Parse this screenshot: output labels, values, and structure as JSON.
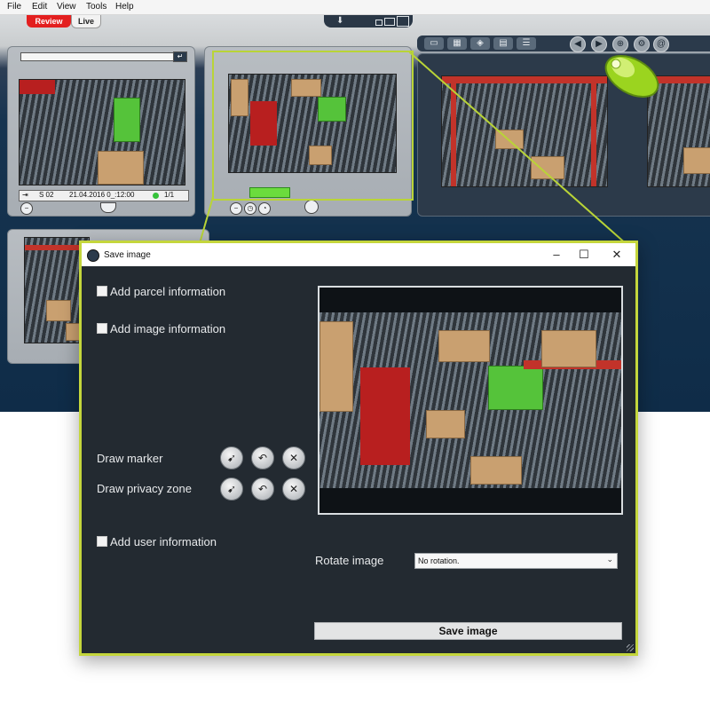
{
  "menubar": {
    "items": [
      "File",
      "Edit",
      "View",
      "Tools",
      "Help"
    ]
  },
  "modes": {
    "review_label": "Review",
    "live_label": "Live",
    "active": "Review"
  },
  "camera_panel": {
    "station": "S 02",
    "datetime": "21.04.2016 0_:12:00",
    "count": "1/1"
  },
  "dialog": {
    "title": "Save image",
    "checkboxes": {
      "parcel": "Add parcel information",
      "image": "Add image information",
      "user": "Add user information"
    },
    "tools": {
      "draw_marker": "Draw marker",
      "draw_privacy_zone": "Draw privacy zone"
    },
    "rotate_label": "Rotate image",
    "rotate_value": "No rotation.",
    "save_button": "Save image"
  },
  "colors": {
    "accent_highlight": "#c4d63c",
    "dialog_bg": "#232a31",
    "review_tab": "#e31f1f",
    "app_header": "#163450"
  },
  "icons": [
    "window-icon",
    "minimize-icon",
    "maximize-icon",
    "close-icon",
    "cursor-select-icon",
    "undo-icon",
    "delete-icon",
    "mouse-icon",
    "chevron-down-icon"
  ]
}
